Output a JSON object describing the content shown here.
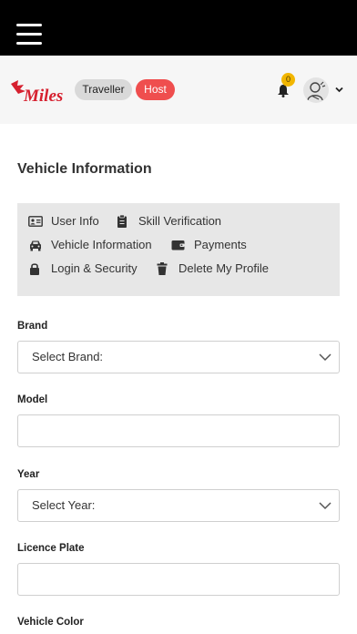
{
  "topbar": {
    "menu_icon": "hamburger-icon"
  },
  "header": {
    "logo_text": "Miles",
    "traveller_label": "Traveller",
    "host_label": "Host",
    "notification_count": "0",
    "colors": {
      "host": "#ef4e4e",
      "badge": "#f2b600",
      "brand": "#d6202f"
    }
  },
  "page": {
    "title": "Vehicle Information"
  },
  "menu": {
    "items": [
      {
        "label": "User Info",
        "icon": "id-card-icon"
      },
      {
        "label": "Skill Verification",
        "icon": "clipboard-icon"
      },
      {
        "label": "Vehicle Information",
        "icon": "car-icon"
      },
      {
        "label": "Payments",
        "icon": "wallet-icon"
      },
      {
        "label": "Login & Security",
        "icon": "lock-icon"
      },
      {
        "label": "Delete My Profile",
        "icon": "trash-icon"
      }
    ]
  },
  "form": {
    "brand": {
      "label": "Brand",
      "value": "Select Brand:"
    },
    "model": {
      "label": "Model",
      "value": ""
    },
    "year": {
      "label": "Year",
      "value": "Select Year:"
    },
    "licence_plate": {
      "label": "Licence Plate",
      "value": ""
    },
    "vehicle_color": {
      "label": "Vehicle Color"
    }
  }
}
